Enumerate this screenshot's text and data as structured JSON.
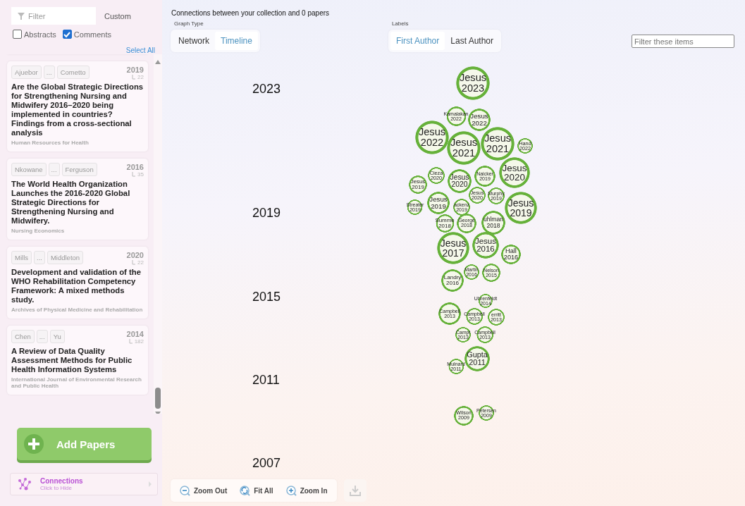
{
  "sidebar": {
    "filter": {
      "placeholder": "Filter"
    },
    "custom": "Custom",
    "checkboxes": [
      {
        "label": "Abstracts",
        "checked": false
      },
      {
        "label": "Comments",
        "checked": true
      }
    ],
    "select_all": "Select All",
    "papers": [
      {
        "first_author": "Ajuebor",
        "ellipsis": "...",
        "last_author": "Cometto",
        "year": "2019",
        "citations": "22",
        "title": "Are the Global Strategic Directions for Strengthening Nursing and Midwifery 2016–2020 being implemented in countries? Findings from a cross-sectional analysis",
        "journal": "Human Resources for Health"
      },
      {
        "first_author": "Nkowane",
        "ellipsis": "...",
        "last_author": "Ferguson",
        "year": "2016",
        "citations": "35",
        "title": "The World Health Organization Launches the 2016-2020 Global Strategic Directions for Strengthening Nursing and Midwifery.",
        "journal": "Nursing Economics"
      },
      {
        "first_author": "Mills",
        "ellipsis": "...",
        "last_author": "Middleton",
        "year": "2020",
        "citations": "22",
        "title": "Development and validation of the WHO Rehabilitation Competency Framework: A mixed methods study.",
        "journal": "Archives of Physical Medicine and Rehabilitation"
      },
      {
        "first_author": "Chen",
        "ellipsis": "...",
        "last_author": "Yu",
        "year": "2014",
        "citations": "182",
        "title": "A Review of Data Quality Assessment Methods for Public Health Information Systems",
        "journal": "International Journal of Environmental Research and Public Health"
      }
    ],
    "add_button": "Add Papers",
    "connections": {
      "title": "Connections",
      "subtitle": "Click to Hide"
    }
  },
  "main": {
    "heading": "Connections between your collection and 0 papers",
    "graph_type": {
      "label": "Graph Type",
      "options": [
        {
          "label": "Network",
          "selected": false
        },
        {
          "label": "Timeline",
          "selected": true
        }
      ]
    },
    "labels": {
      "label": "Labels",
      "options": [
        {
          "label": "First Author",
          "selected": true
        },
        {
          "label": "Last Author",
          "selected": false
        }
      ]
    },
    "filter": {
      "placeholder": "Filter these items"
    },
    "timeline": {
      "years": [
        "2023",
        "2019",
        "2015",
        "2011",
        "2007"
      ],
      "nodes": [
        {
          "name": "Jesus",
          "year": "2023"
        },
        {
          "name": "Kamalakan",
          "year": "2022"
        },
        {
          "name": "Jesus",
          "year": "2022"
        },
        {
          "name": "Jesus",
          "year": "2022"
        },
        {
          "name": "Jesus",
          "year": "2021"
        },
        {
          "name": "Jesus",
          "year": "2021"
        },
        {
          "name": "Hand",
          "year": "2022"
        },
        {
          "name": "Cieza",
          "year": "2020"
        },
        {
          "name": "Jesus",
          "year": "2019"
        },
        {
          "name": "Jesus",
          "year": "2020"
        },
        {
          "name": "Naicker",
          "year": "2019"
        },
        {
          "name": "Jesus",
          "year": "2020"
        },
        {
          "name": "Jesus",
          "year": "2020"
        },
        {
          "name": "Murphy",
          "year": "2019"
        },
        {
          "name": "Streater",
          "year": "2019"
        },
        {
          "name": "Jesus",
          "year": "2019"
        },
        {
          "name": "ackenz",
          "year": "2019"
        },
        {
          "name": "Jesus",
          "year": "2019"
        },
        {
          "name": "Summe",
          "year": "2018"
        },
        {
          "name": "George",
          "year": "2018"
        },
        {
          "name": "uhlman",
          "year": "2018"
        },
        {
          "name": "Jesus",
          "year": "2017"
        },
        {
          "name": "Jesus",
          "year": "2016"
        },
        {
          "name": "Hall",
          "year": "2016"
        },
        {
          "name": "Martin",
          "year": "2016"
        },
        {
          "name": "Nelson",
          "year": "2015"
        },
        {
          "name": "Landry",
          "year": "2016"
        },
        {
          "name": "Uhrenfeldt",
          "year": "2014"
        },
        {
          "name": "Campbell",
          "year": "2013"
        },
        {
          "name": "Campbell",
          "year": "2013"
        },
        {
          "name": "erritt",
          "year": "2013"
        },
        {
          "name": "Campt",
          "year": "2013"
        },
        {
          "name": "Campbell",
          "year": "2013"
        },
        {
          "name": "Gupta",
          "year": "2011"
        },
        {
          "name": "Mulnard",
          "year": "2011"
        },
        {
          "name": "Wilson",
          "year": "2009"
        },
        {
          "name": "Petersen",
          "year": "2009"
        }
      ]
    },
    "toolbar": [
      {
        "label": "Zoom Out",
        "kind": "zoom-out"
      },
      {
        "label": "Fit All",
        "kind": "fit"
      },
      {
        "label": "Zoom In",
        "kind": "zoom-in"
      }
    ]
  }
}
